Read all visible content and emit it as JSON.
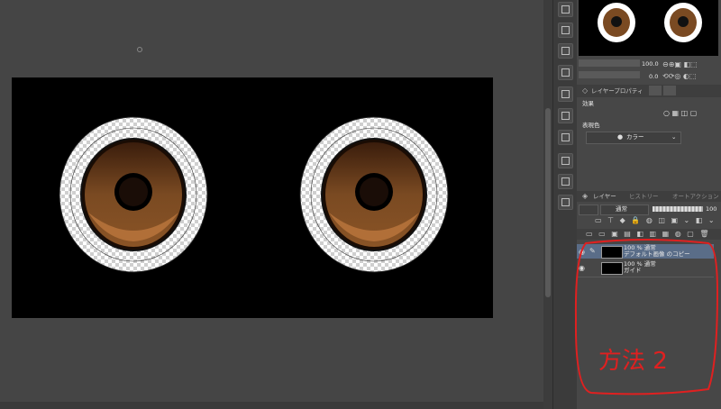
{
  "navigator": {
    "zoom": "100.0",
    "rotate": "0.0"
  },
  "layer_property": {
    "tab_label": "レイヤープロパティ",
    "effect_label": "効果",
    "expression_color_label": "表現色",
    "expression_color_value": "カラー"
  },
  "layers_panel": {
    "tab_layer": "レイヤー",
    "tab_history": "ヒストリー",
    "tab_auto_action": "オートアクション",
    "blend_mode": "通常",
    "opacity": "100",
    "layers": [
      {
        "line1": "100 % 通常",
        "line2": "デフォルト画像 のコピー"
      },
      {
        "line1": "100 % 通常",
        "line2": "ガイド"
      }
    ]
  },
  "annotation": {
    "text": "方法 2",
    "color": "#e02020"
  },
  "colors": {
    "canvas_bg": "#454545",
    "document_bg": "#000000",
    "panel_bg": "#474747",
    "selected_layer": "#5a6d88",
    "iris": "#7a4a22"
  }
}
